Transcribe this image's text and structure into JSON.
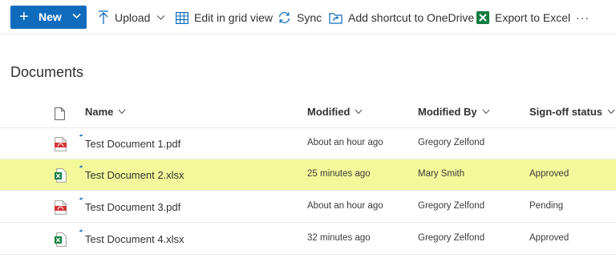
{
  "toolbar": {
    "new_label": "New",
    "upload_label": "Upload",
    "grid_label": "Edit in grid view",
    "sync_label": "Sync",
    "shortcut_label": "Add shortcut to OneDrive",
    "export_label": "Export to Excel",
    "more_label": "···"
  },
  "page": {
    "title": "Documents"
  },
  "columns": {
    "name": "Name",
    "modified": "Modified",
    "modified_by": "Modified By",
    "signoff": "Sign-off status"
  },
  "rows": [
    {
      "name": "Test Document 1.pdf",
      "type": "pdf",
      "modified": "About an hour ago",
      "modified_by": "Gregory Zelfond",
      "signoff": "",
      "selected": false
    },
    {
      "name": "Test Document 2.xlsx",
      "type": "xlsx",
      "modified": "25 minutes ago",
      "modified_by": "Mary Smith",
      "signoff": "Approved",
      "selected": true
    },
    {
      "name": "Test Document 3.pdf",
      "type": "pdf",
      "modified": "About an hour ago",
      "modified_by": "Gregory Zelfond",
      "signoff": "Pending",
      "selected": false
    },
    {
      "name": "Test Document 4.xlsx",
      "type": "xlsx",
      "modified": "32 minutes ago",
      "modified_by": "Gregory Zelfond",
      "signoff": "Approved",
      "selected": false
    }
  ],
  "colors": {
    "accent": "#0f6cbd",
    "highlight": "#f3f99a",
    "pdf_red": "#d13438",
    "excel_green": "#107c41"
  }
}
